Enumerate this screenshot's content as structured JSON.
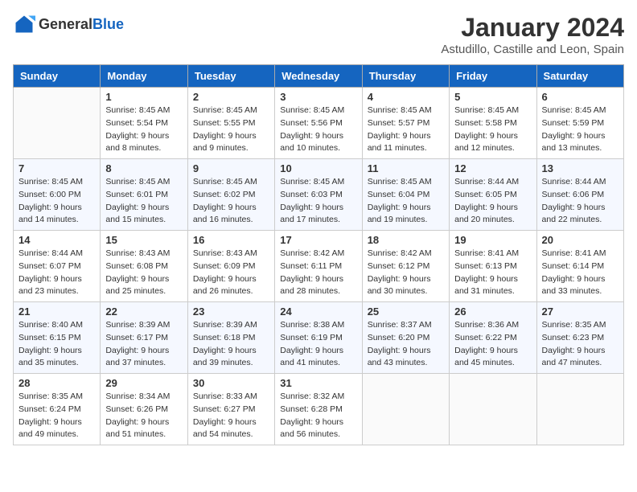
{
  "header": {
    "logo_general": "General",
    "logo_blue": "Blue",
    "month_title": "January 2024",
    "location": "Astudillo, Castille and Leon, Spain"
  },
  "weekdays": [
    "Sunday",
    "Monday",
    "Tuesday",
    "Wednesday",
    "Thursday",
    "Friday",
    "Saturday"
  ],
  "weeks": [
    [
      {
        "day": "",
        "info": ""
      },
      {
        "day": "1",
        "info": "Sunrise: 8:45 AM\nSunset: 5:54 PM\nDaylight: 9 hours\nand 8 minutes."
      },
      {
        "day": "2",
        "info": "Sunrise: 8:45 AM\nSunset: 5:55 PM\nDaylight: 9 hours\nand 9 minutes."
      },
      {
        "day": "3",
        "info": "Sunrise: 8:45 AM\nSunset: 5:56 PM\nDaylight: 9 hours\nand 10 minutes."
      },
      {
        "day": "4",
        "info": "Sunrise: 8:45 AM\nSunset: 5:57 PM\nDaylight: 9 hours\nand 11 minutes."
      },
      {
        "day": "5",
        "info": "Sunrise: 8:45 AM\nSunset: 5:58 PM\nDaylight: 9 hours\nand 12 minutes."
      },
      {
        "day": "6",
        "info": "Sunrise: 8:45 AM\nSunset: 5:59 PM\nDaylight: 9 hours\nand 13 minutes."
      }
    ],
    [
      {
        "day": "7",
        "info": "Sunrise: 8:45 AM\nSunset: 6:00 PM\nDaylight: 9 hours\nand 14 minutes."
      },
      {
        "day": "8",
        "info": "Sunrise: 8:45 AM\nSunset: 6:01 PM\nDaylight: 9 hours\nand 15 minutes."
      },
      {
        "day": "9",
        "info": "Sunrise: 8:45 AM\nSunset: 6:02 PM\nDaylight: 9 hours\nand 16 minutes."
      },
      {
        "day": "10",
        "info": "Sunrise: 8:45 AM\nSunset: 6:03 PM\nDaylight: 9 hours\nand 17 minutes."
      },
      {
        "day": "11",
        "info": "Sunrise: 8:45 AM\nSunset: 6:04 PM\nDaylight: 9 hours\nand 19 minutes."
      },
      {
        "day": "12",
        "info": "Sunrise: 8:44 AM\nSunset: 6:05 PM\nDaylight: 9 hours\nand 20 minutes."
      },
      {
        "day": "13",
        "info": "Sunrise: 8:44 AM\nSunset: 6:06 PM\nDaylight: 9 hours\nand 22 minutes."
      }
    ],
    [
      {
        "day": "14",
        "info": "Sunrise: 8:44 AM\nSunset: 6:07 PM\nDaylight: 9 hours\nand 23 minutes."
      },
      {
        "day": "15",
        "info": "Sunrise: 8:43 AM\nSunset: 6:08 PM\nDaylight: 9 hours\nand 25 minutes."
      },
      {
        "day": "16",
        "info": "Sunrise: 8:43 AM\nSunset: 6:09 PM\nDaylight: 9 hours\nand 26 minutes."
      },
      {
        "day": "17",
        "info": "Sunrise: 8:42 AM\nSunset: 6:11 PM\nDaylight: 9 hours\nand 28 minutes."
      },
      {
        "day": "18",
        "info": "Sunrise: 8:42 AM\nSunset: 6:12 PM\nDaylight: 9 hours\nand 30 minutes."
      },
      {
        "day": "19",
        "info": "Sunrise: 8:41 AM\nSunset: 6:13 PM\nDaylight: 9 hours\nand 31 minutes."
      },
      {
        "day": "20",
        "info": "Sunrise: 8:41 AM\nSunset: 6:14 PM\nDaylight: 9 hours\nand 33 minutes."
      }
    ],
    [
      {
        "day": "21",
        "info": "Sunrise: 8:40 AM\nSunset: 6:15 PM\nDaylight: 9 hours\nand 35 minutes."
      },
      {
        "day": "22",
        "info": "Sunrise: 8:39 AM\nSunset: 6:17 PM\nDaylight: 9 hours\nand 37 minutes."
      },
      {
        "day": "23",
        "info": "Sunrise: 8:39 AM\nSunset: 6:18 PM\nDaylight: 9 hours\nand 39 minutes."
      },
      {
        "day": "24",
        "info": "Sunrise: 8:38 AM\nSunset: 6:19 PM\nDaylight: 9 hours\nand 41 minutes."
      },
      {
        "day": "25",
        "info": "Sunrise: 8:37 AM\nSunset: 6:20 PM\nDaylight: 9 hours\nand 43 minutes."
      },
      {
        "day": "26",
        "info": "Sunrise: 8:36 AM\nSunset: 6:22 PM\nDaylight: 9 hours\nand 45 minutes."
      },
      {
        "day": "27",
        "info": "Sunrise: 8:35 AM\nSunset: 6:23 PM\nDaylight: 9 hours\nand 47 minutes."
      }
    ],
    [
      {
        "day": "28",
        "info": "Sunrise: 8:35 AM\nSunset: 6:24 PM\nDaylight: 9 hours\nand 49 minutes."
      },
      {
        "day": "29",
        "info": "Sunrise: 8:34 AM\nSunset: 6:26 PM\nDaylight: 9 hours\nand 51 minutes."
      },
      {
        "day": "30",
        "info": "Sunrise: 8:33 AM\nSunset: 6:27 PM\nDaylight: 9 hours\nand 54 minutes."
      },
      {
        "day": "31",
        "info": "Sunrise: 8:32 AM\nSunset: 6:28 PM\nDaylight: 9 hours\nand 56 minutes."
      },
      {
        "day": "",
        "info": ""
      },
      {
        "day": "",
        "info": ""
      },
      {
        "day": "",
        "info": ""
      }
    ]
  ]
}
